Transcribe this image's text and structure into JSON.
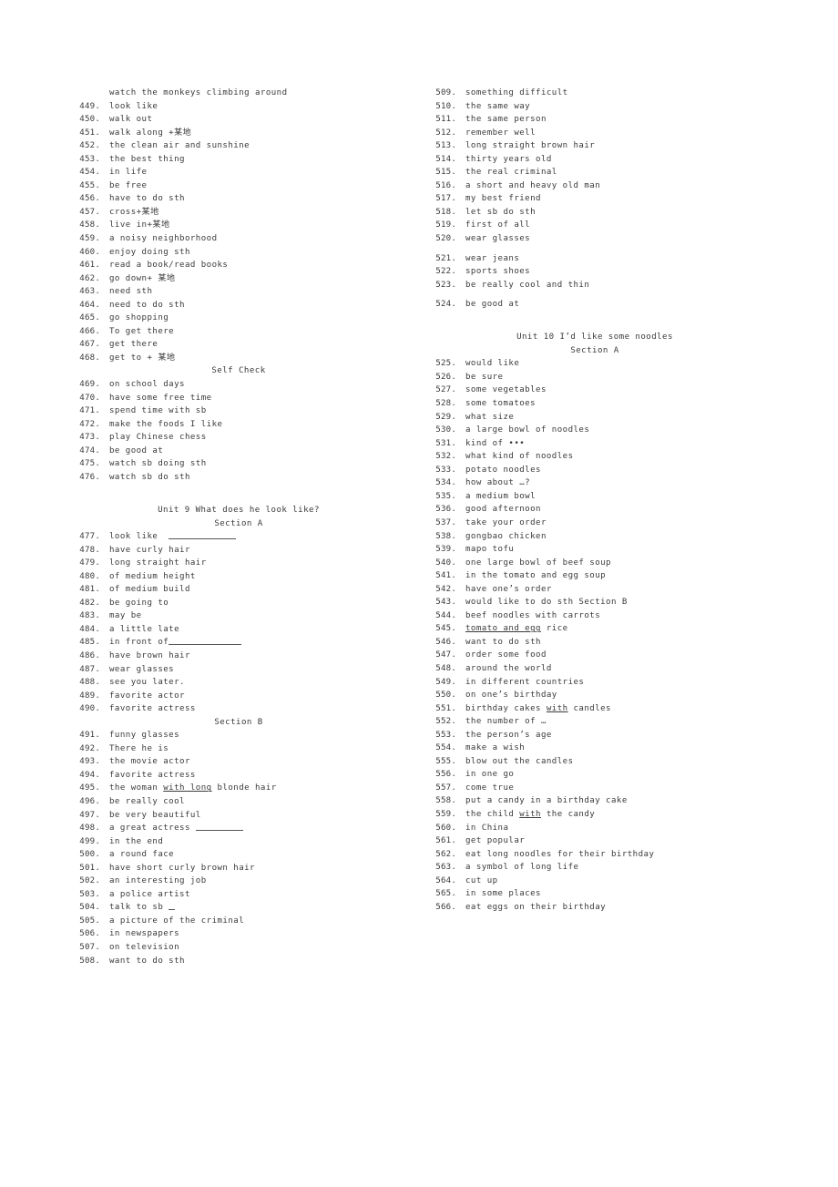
{
  "document": {
    "type": "vocabulary-phrase-list",
    "text_color": "#3a3a3a",
    "background_color": "#ffffff",
    "columns": 2
  },
  "left_column": {
    "lead_line": "watch the monkeys climbing around",
    "items": [
      {
        "num": "449.",
        "text": "look like"
      },
      {
        "num": "450.",
        "text": "walk out"
      },
      {
        "num": "451.",
        "text": "walk along +某地"
      },
      {
        "num": "452.",
        "text": "the clean air and sunshine"
      },
      {
        "num": "453.",
        "text": "the best thing"
      },
      {
        "num": "454.",
        "text": "in life"
      },
      {
        "num": "455.",
        "text": "be free"
      },
      {
        "num": "456.",
        "text": "have to do sth"
      },
      {
        "num": "457.",
        "text": "cross+某地"
      },
      {
        "num": "458.",
        "text": "live in+某地"
      },
      {
        "num": "459.",
        "text": "a noisy neighborhood"
      },
      {
        "num": "460.",
        "text": "enjoy doing sth"
      },
      {
        "num": "461.",
        "text": "read a book/read books"
      },
      {
        "num": "462.",
        "text": "go down+ 某地"
      },
      {
        "num": "463.",
        "text": "need sth"
      },
      {
        "num": "464.",
        "text": "need to do sth"
      },
      {
        "num": "465.",
        "text": "go shopping"
      },
      {
        "num": "466.",
        "text": "To get there"
      },
      {
        "num": "467.",
        "text": "get there"
      },
      {
        "num": "468.",
        "text": "get to + 某地"
      }
    ],
    "heading_self_check": "Self Check",
    "items2": [
      {
        "num": "469.",
        "text": "on school days"
      },
      {
        "num": "470.",
        "text": "have some free time"
      },
      {
        "num": "471.",
        "text": "spend time with sb"
      },
      {
        "num": "472.",
        "text": "make the foods I like"
      },
      {
        "num": "473.",
        "text": "play Chinese chess"
      },
      {
        "num": "474.",
        "text": "be good at"
      },
      {
        "num": "475.",
        "text": "watch sb doing sth"
      },
      {
        "num": "476.",
        "text": "watch sb do sth"
      }
    ],
    "heading_unit9": "Unit 9 What does he look like?",
    "heading_section_a": "Section A",
    "items3": [
      {
        "num": "477.",
        "text": "look like",
        "blank": "long"
      },
      {
        "num": "478.",
        "text": "have curly hair"
      },
      {
        "num": "479.",
        "text": "long straight hair"
      },
      {
        "num": "480.",
        "text": "of medium height"
      },
      {
        "num": "481.",
        "text": "of medium build"
      },
      {
        "num": "482.",
        "text": "be going to"
      },
      {
        "num": "483.",
        "text": "may be"
      },
      {
        "num": "484.",
        "text": "a little late"
      },
      {
        "num": "485.",
        "text": "in front of",
        "blank": "long-attached"
      },
      {
        "num": "486.",
        "text": "have brown hair"
      },
      {
        "num": "487.",
        "text": "wear glasses"
      },
      {
        "num": "488.",
        "text": "see you later."
      },
      {
        "num": "489.",
        "text": "favorite actor"
      },
      {
        "num": "490.",
        "text": "favorite actress"
      }
    ],
    "heading_section_b": "Section B",
    "items4": [
      {
        "num": "491.",
        "text": "funny glasses"
      },
      {
        "num": "492.",
        "text": "There he is"
      },
      {
        "num": "493.",
        "text": "the movie actor"
      },
      {
        "num": "494.",
        "text": "favorite actress"
      },
      {
        "num": "495.",
        "text_pre": "the woman ",
        "underlined": "with long",
        "text_post": " blonde hair"
      },
      {
        "num": "496.",
        "text": "be really cool"
      },
      {
        "num": "497.",
        "text": "be very beautiful"
      },
      {
        "num": "498.",
        "text": "a great actress ",
        "blank": "short"
      },
      {
        "num": "499.",
        "text": "in the end"
      },
      {
        "num": "500.",
        "text": "a round face"
      },
      {
        "num": "501.",
        "text": "have short curly brown hair"
      },
      {
        "num": "502.",
        "text": "an interesting job"
      },
      {
        "num": "503.",
        "text": "a police artist"
      },
      {
        "num": "504.",
        "text": "talk to sb ",
        "blank": "tiny"
      },
      {
        "num": "505.",
        "text": "a picture of the criminal"
      },
      {
        "num": "506.",
        "text": "in newspapers"
      },
      {
        "num": "507.",
        "text": "on television"
      },
      {
        "num": "508.",
        "text": "want to do sth"
      }
    ]
  },
  "right_column": {
    "items": [
      {
        "num": "509.",
        "text": "something difficult"
      },
      {
        "num": "510.",
        "text": "the same way"
      },
      {
        "num": "511.",
        "text": "the same person"
      },
      {
        "num": "512.",
        "text": "remember well"
      },
      {
        "num": "513.",
        "text": "long straight brown hair"
      },
      {
        "num": "514.",
        "text": "thirty years old"
      },
      {
        "num": "515.",
        "text": "the real criminal"
      },
      {
        "num": "516.",
        "text": "a short and heavy old man"
      },
      {
        "num": "517.",
        "text": "my best friend"
      },
      {
        "num": "518.",
        "text": "let sb do sth"
      },
      {
        "num": "519.",
        "text": "first of all"
      },
      {
        "num": "520.",
        "text": "wear glasses"
      },
      {
        "num": "521.",
        "text": "wear jeans"
      },
      {
        "num": "522.",
        "text": "sports shoes"
      },
      {
        "num": "523.",
        "text": "be really cool and thin"
      },
      {
        "num": "524.",
        "text": "be good at"
      }
    ],
    "heading_unit10": "Unit 10 I’d like some noodles",
    "heading_section_a": "Section A",
    "items2": [
      {
        "num": "525.",
        "text": "would like"
      },
      {
        "num": "526.",
        "text": "be sure"
      },
      {
        "num": "527.",
        "text": "some vegetables"
      },
      {
        "num": "528.",
        "text": "some tomatoes"
      },
      {
        "num": "529.",
        "text": "what size"
      },
      {
        "num": "530.",
        "text": "a large bowl of noodles"
      },
      {
        "num": "531.",
        "text": "kind of •••"
      },
      {
        "num": "532.",
        "text": "what kind of noodles"
      },
      {
        "num": "533.",
        "text": "potato noodles"
      },
      {
        "num": "534.",
        "text": "how about …?"
      },
      {
        "num": "535.",
        "text": "a medium bowl"
      },
      {
        "num": "536.",
        "text": "good afternoon"
      },
      {
        "num": "537.",
        "text": "take your order"
      },
      {
        "num": "538.",
        "text": "gongbao chicken"
      },
      {
        "num": "539.",
        "text": "mapo tofu"
      },
      {
        "num": "540.",
        "text": "one large bowl of beef soup"
      },
      {
        "num": "541.",
        "text": "in the tomato and egg soup"
      },
      {
        "num": "542.",
        "text": "have one’s order"
      },
      {
        "num": "543.",
        "text": "would like to do sth Section B"
      },
      {
        "num": "544.",
        "text": "beef noodles with carrots"
      },
      {
        "num": "545.",
        "underlined": "tomato and egg",
        "text_post": " rice"
      },
      {
        "num": "546.",
        "text": "want to do sth"
      },
      {
        "num": "547.",
        "text": "order some food"
      },
      {
        "num": "548.",
        "text": "around the world"
      },
      {
        "num": "549.",
        "text": "in different countries"
      },
      {
        "num": "550.",
        "text": "on one’s birthday"
      },
      {
        "num": "551.",
        "text_pre": "birthday cakes ",
        "underlined": "with",
        "text_post": " candles"
      },
      {
        "num": "552.",
        "text": "the number of …"
      },
      {
        "num": "553.",
        "text": "the person’s age"
      },
      {
        "num": "554.",
        "text": "make a wish"
      },
      {
        "num": "555.",
        "text": "blow out the candles"
      },
      {
        "num": "556.",
        "text": "in one go"
      },
      {
        "num": "557.",
        "text": "come true"
      },
      {
        "num": "558.",
        "text": "put a candy in a birthday cake"
      },
      {
        "num": "559.",
        "text_pre": "the child ",
        "underlined": "with",
        "text_post": " the candy"
      },
      {
        "num": "560.",
        "text": "in China"
      },
      {
        "num": "561.",
        "text": "get popular"
      },
      {
        "num": "562.",
        "text": "eat long noodles for their birthday"
      },
      {
        "num": "563.",
        "text": "a symbol of long life"
      },
      {
        "num": "564.",
        "text": "cut up"
      },
      {
        "num": "565.",
        "text": "in some places"
      },
      {
        "num": "566.",
        "text": "eat eggs on their birthday"
      }
    ]
  }
}
